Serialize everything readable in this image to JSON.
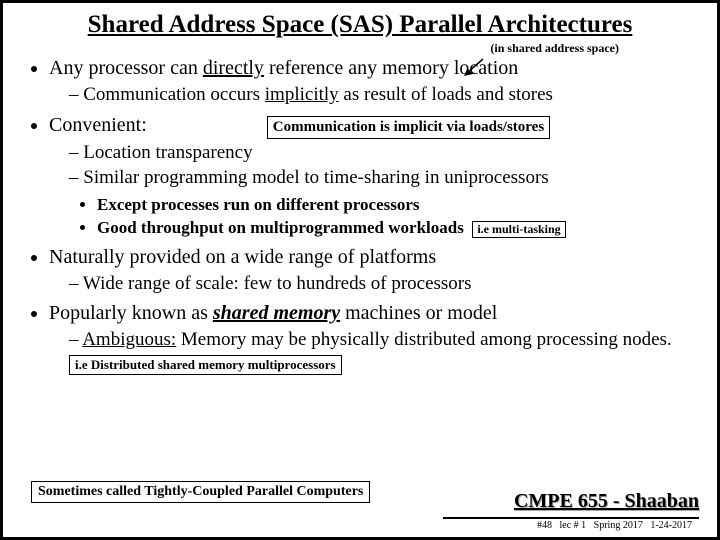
{
  "title": "Shared Address Space (SAS) Parallel Architectures",
  "annot_top": "(in shared address space)",
  "b1": {
    "pre": "Any processor can ",
    "u": "directly",
    "post": " reference any memory location",
    "sub1": {
      "pre": "Communication occurs ",
      "u": "implicitly",
      "post": " as result of loads and stores"
    }
  },
  "callout1": "Communication is implicit via loads/stores",
  "b2": {
    "label": "Convenient:",
    "sub1": "Location transparency",
    "sub2": "Similar programming model to time-sharing in uniprocessors",
    "dot1": "Except processes run on different processors",
    "dot2": "Good throughput on multiprogrammed workloads"
  },
  "callout2": "i.e multi-tasking",
  "b3": {
    "text": "Naturally provided on a wide range of platforms",
    "sub1": "Wide range of scale: few to hundreds of processors"
  },
  "b4": {
    "pre": "Popularly known as ",
    "bi": "shared memory",
    "post": " machines or model",
    "sub1": {
      "u": "Ambiguous:",
      "post": "  Memory may be physically distributed among processing nodes."
    }
  },
  "callout3": "i.e Distributed shared memory multiprocessors",
  "footer_box": "Sometimes called Tightly-Coupled Parallel Computers",
  "brand": "CMPE 655 - Shaaban",
  "meta": {
    "num": "#48",
    "lec": "lec # 1",
    "term": "Spring 2017",
    "date": "1-24-2017"
  }
}
